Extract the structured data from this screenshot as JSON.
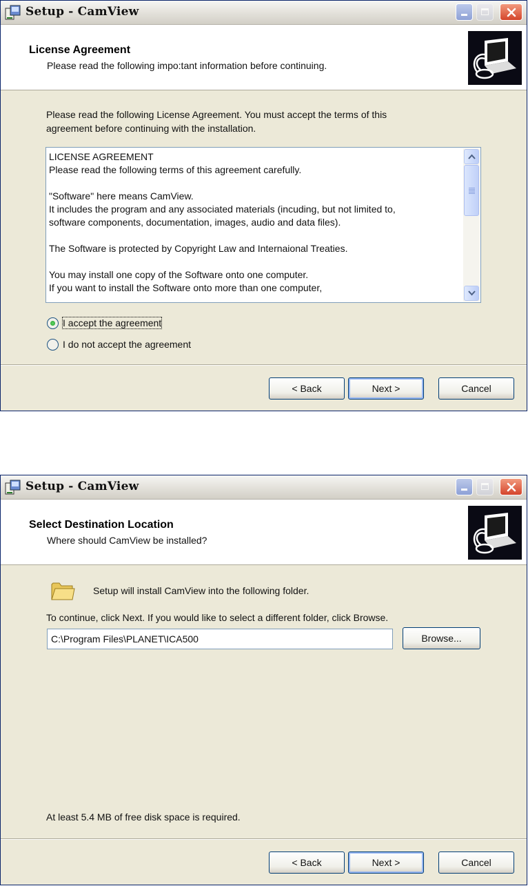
{
  "license_window": {
    "title": "Setup - CamView",
    "header_title": "License Agreement",
    "header_subtitle": "Please read the following impo:tant information before continuing.",
    "intro_line1": "Please read the following License Agreement. You must accept the terms of this",
    "intro_line2": "agreement before continuing with the installation.",
    "license_text": [
      "LICENSE AGREEMENT",
      "Please read the following terms of this agreement carefully.",
      "",
      "\"Software\" here means CamView.",
      "It includes the program and any associated materials (incuding, but not limited to,",
      "software components, documentation, images, audio and data files).",
      "",
      "The Software is protected by Copyright Law  and Internaional Treaties.",
      "",
      "You may install one copy of the Software onto one computer.",
      "If you want to install the Software onto more than one computer,"
    ],
    "radio_accept": "I accept the agreement",
    "radio_decline": "I do not accept the agreement",
    "accept_selected": true,
    "back_label": "< Back",
    "next_label": "Next >",
    "cancel_label": "Cancel"
  },
  "destination_window": {
    "title": "Setup - CamView",
    "header_title": "Select Destination Location",
    "header_subtitle": "Where should CamView be installed?",
    "install_text": "Setup will install CamView into the following folder.",
    "continue_text": "To continue, click Next. If you would like to select a different folder, click Browse.",
    "install_path": "C:\\Program Files\\PLANET\\ICA500",
    "browse_label": "Browse...",
    "disk_space_text": "At least 5.4 MB of free disk space is required.",
    "back_label": "< Back",
    "next_label": "Next >",
    "cancel_label": "Cancel"
  },
  "icons": {
    "app": "setup-app-icon",
    "wizard": "computer-disk-icon",
    "folder": "folder-icon",
    "minimize": "minimize-icon",
    "maximize": "maximize-icon",
    "close": "close-icon"
  },
  "colors": {
    "dialog_bg": "#ece9d8",
    "header_bg": "#ffffff",
    "close_red": "#d4452b",
    "radio_green": "#21a125"
  }
}
